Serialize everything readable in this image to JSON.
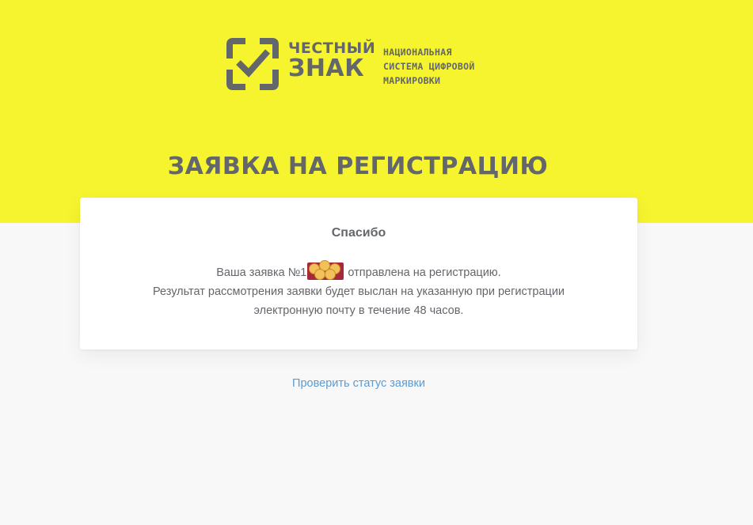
{
  "logo": {
    "icon": "checkmark-bracket-logo-icon",
    "name_line1": "ЧЕСТНЫЙ",
    "name_line2": "ЗНАК",
    "tagline": [
      "НАЦИОНАЛЬНАЯ",
      "СИСТЕМА ЦИФРОВОЙ",
      "МАРКИРОВКИ"
    ]
  },
  "page": {
    "title": "ЗАЯВКА НА РЕГИСТРАЦИЮ"
  },
  "card": {
    "title": "Спасибо",
    "line1_before": "Ваша заявка №1",
    "line1_after": " отправлена на регистрацию.",
    "line2": "Результат рассмотрения заявки будет выслан на указанную при регистрации",
    "line3": "электронную почту в течение 48 часов."
  },
  "links": {
    "check_status": "Проверить статус заявки"
  },
  "colors": {
    "accent_yellow": "#f6f42e",
    "text_gray": "#63666a",
    "link_blue": "#5b9bd1",
    "background": "#f8f8f8"
  }
}
